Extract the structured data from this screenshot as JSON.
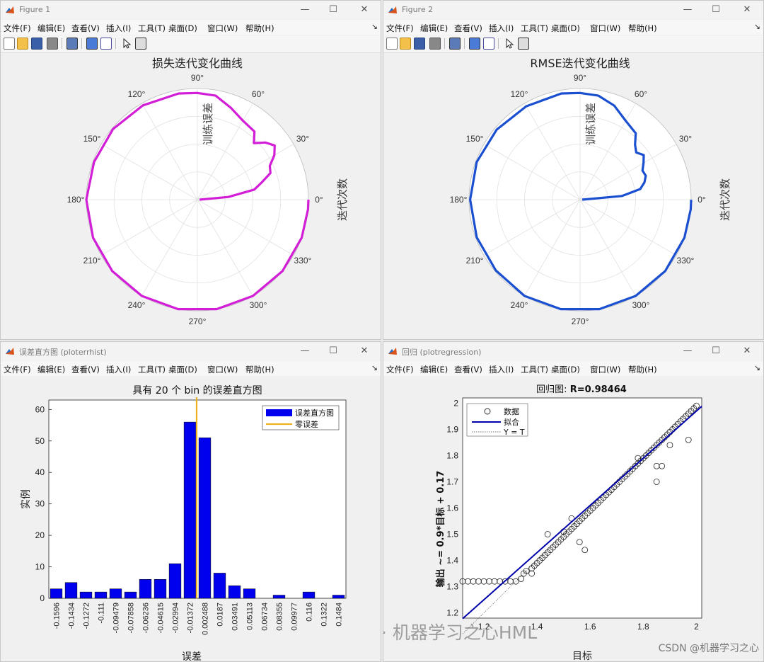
{
  "menu_labels": [
    "文件(F)",
    "编辑(E)",
    "查看(V)",
    "插入(I)",
    "工具(T)",
    "桌面(D)",
    "窗口(W)",
    "帮助(H)"
  ],
  "window_controls": {
    "minimize": "—",
    "maximize": "☐",
    "close": "✕"
  },
  "fig1": {
    "window_title": "Figure 1",
    "plot_title": "损失迭代变化曲线",
    "radial_label": "训练误差",
    "side_label": "迭代次数",
    "angle_labels": [
      "0°",
      "30°",
      "60°",
      "90°",
      "120°",
      "150°",
      "180°",
      "210°",
      "240°",
      "270°",
      "300°",
      "330°"
    ],
    "line_color": "#d21ed6"
  },
  "fig2": {
    "window_title": "Figure 2",
    "plot_title": "RMSE迭代变化曲线",
    "radial_label": "训练误差",
    "side_label": "迭代次数",
    "angle_labels": [
      "0°",
      "30°",
      "60°",
      "90°",
      "120°",
      "150°",
      "180°",
      "210°",
      "240°",
      "270°",
      "300°",
      "330°"
    ],
    "line_color": "#1a4fd0"
  },
  "hist": {
    "window_title": "误差直方图 (ploterrhist)",
    "legend_bar": "误差直方图",
    "legend_line": "零误差",
    "bar_color": "#0000ee",
    "zero_line_color": "#edb120"
  },
  "reg": {
    "window_title": "回归 (plotregression)",
    "legend_data": "数据",
    "legend_fit": "拟合",
    "legend_yt": "Y = T",
    "fit_color": "#0000aa"
  },
  "watermark": {
    "text": "公众号 · 机器学习之心HML",
    "csdn": "CSDN @机器学习之心"
  },
  "chart_data": [
    {
      "type": "line",
      "title": "损失迭代变化曲线",
      "polar": true,
      "radial_label": "训练误差",
      "angle_label": "迭代次数",
      "theta_ticks": [
        "0°",
        "30°",
        "60°",
        "90°",
        "120°",
        "150°",
        "180°",
        "210°",
        "240°",
        "270°",
        "300°",
        "330°"
      ],
      "theta_deg": [
        0,
        5,
        10,
        15,
        20,
        25,
        30,
        35,
        40,
        45,
        50,
        60,
        70,
        80,
        90,
        100,
        120,
        140,
        160,
        180,
        200,
        220,
        240,
        260,
        280,
        300,
        320,
        340,
        355,
        360
      ],
      "r": [
        0.02,
        0.28,
        0.52,
        0.6,
        0.7,
        0.72,
        0.8,
        0.85,
        0.8,
        0.72,
        0.8,
        0.82,
        0.88,
        0.95,
        0.96,
        0.97,
        0.98,
        0.99,
        0.99,
        1.0,
        1.0,
        1.0,
        1.0,
        1.0,
        1.0,
        1.0,
        1.0,
        1.0,
        1.0,
        1.0
      ]
    },
    {
      "type": "line",
      "title": "RMSE迭代变化曲线",
      "polar": true,
      "radial_label": "训练误差",
      "angle_label": "迭代次数",
      "theta_ticks": [
        "0°",
        "30°",
        "60°",
        "90°",
        "120°",
        "150°",
        "180°",
        "210°",
        "240°",
        "270°",
        "300°",
        "330°"
      ],
      "theta_deg": [
        0,
        5,
        10,
        15,
        20,
        25,
        30,
        35,
        40,
        45,
        50,
        60,
        70,
        80,
        90,
        100,
        120,
        140,
        160,
        180,
        200,
        220,
        240,
        260,
        280,
        300,
        320,
        340,
        355,
        360
      ],
      "r": [
        0.02,
        0.38,
        0.55,
        0.6,
        0.63,
        0.62,
        0.66,
        0.7,
        0.66,
        0.7,
        0.78,
        0.82,
        0.9,
        0.95,
        0.96,
        0.97,
        0.97,
        0.98,
        0.99,
        0.99,
        0.99,
        0.99,
        1.0,
        1.0,
        1.0,
        1.0,
        1.0,
        1.0,
        1.0,
        1.0
      ]
    },
    {
      "type": "bar",
      "title": "具有 20 个 bin 的误差直方图",
      "xlabel": "误差",
      "ylabel": "实例",
      "ylim": [
        0,
        63
      ],
      "yticks": [
        0,
        10,
        20,
        30,
        40,
        50,
        60
      ],
      "categories": [
        "-0.1596",
        "-0.1434",
        "-0.1272",
        "-0.111",
        "-0.09479",
        "-0.07858",
        "-0.06236",
        "-0.04615",
        "-0.02994",
        "-0.01372",
        "0.002488",
        "0.0187",
        "0.03491",
        "0.05113",
        "0.06734",
        "0.08355",
        "0.09977",
        "0.116",
        "0.1322",
        "0.1484"
      ],
      "values": [
        3,
        5,
        2,
        2,
        3,
        2,
        6,
        6,
        11,
        56,
        51,
        8,
        4,
        3,
        0,
        1,
        0,
        2,
        0,
        1
      ],
      "zero_error_index": 10,
      "legend": [
        "误差直方图",
        "零误差"
      ],
      "legend_position": "top-right"
    },
    {
      "type": "scatter",
      "title": "回归图: R=0.98464",
      "xlabel": "目标",
      "ylabel": "输出 ~= 0.9*目标 + 0.17",
      "xlim": [
        1.12,
        2.02
      ],
      "ylim": [
        1.18,
        2.02
      ],
      "xticks": [
        1.2,
        1.4,
        1.6,
        1.8,
        2
      ],
      "yticks": [
        1.2,
        1.3,
        1.4,
        1.5,
        1.6,
        1.7,
        1.8,
        1.9,
        2
      ],
      "fit": {
        "slope": 0.9,
        "intercept": 0.17
      },
      "legend": [
        "数据",
        "拟合",
        "Y = T"
      ],
      "legend_position": "top-left",
      "x": [
        1.12,
        1.14,
        1.16,
        1.18,
        1.2,
        1.22,
        1.24,
        1.26,
        1.28,
        1.3,
        1.32,
        1.34,
        1.35,
        1.36,
        1.38,
        1.39,
        1.4,
        1.41,
        1.42,
        1.43,
        1.44,
        1.45,
        1.46,
        1.47,
        1.48,
        1.49,
        1.5,
        1.5,
        1.51,
        1.52,
        1.53,
        1.54,
        1.55,
        1.56,
        1.57,
        1.58,
        1.59,
        1.6,
        1.61,
        1.62,
        1.63,
        1.64,
        1.65,
        1.66,
        1.67,
        1.68,
        1.69,
        1.7,
        1.71,
        1.72,
        1.73,
        1.74,
        1.75,
        1.76,
        1.77,
        1.78,
        1.79,
        1.8,
        1.81,
        1.82,
        1.83,
        1.84,
        1.85,
        1.86,
        1.87,
        1.88,
        1.89,
        1.9,
        1.91,
        1.92,
        1.93,
        1.94,
        1.95,
        1.96,
        1.97,
        1.98,
        1.99,
        2.0,
        1.53,
        1.58,
        1.38,
        1.85,
        1.9,
        1.97,
        1.85,
        1.87,
        1.44,
        1.56,
        1.78
      ],
      "y": [
        1.32,
        1.32,
        1.32,
        1.32,
        1.32,
        1.32,
        1.32,
        1.32,
        1.32,
        1.32,
        1.32,
        1.33,
        1.35,
        1.36,
        1.37,
        1.38,
        1.39,
        1.4,
        1.41,
        1.42,
        1.43,
        1.44,
        1.45,
        1.46,
        1.47,
        1.48,
        1.49,
        1.51,
        1.5,
        1.51,
        1.52,
        1.53,
        1.54,
        1.55,
        1.56,
        1.57,
        1.58,
        1.59,
        1.6,
        1.61,
        1.62,
        1.63,
        1.64,
        1.65,
        1.66,
        1.67,
        1.68,
        1.69,
        1.7,
        1.71,
        1.72,
        1.73,
        1.74,
        1.75,
        1.76,
        1.77,
        1.78,
        1.79,
        1.8,
        1.81,
        1.82,
        1.83,
        1.84,
        1.85,
        1.86,
        1.87,
        1.88,
        1.89,
        1.9,
        1.91,
        1.92,
        1.93,
        1.94,
        1.95,
        1.96,
        1.97,
        1.98,
        1.99,
        1.56,
        1.44,
        1.35,
        1.7,
        1.84,
        1.86,
        1.76,
        1.76,
        1.5,
        1.47,
        1.79
      ]
    }
  ]
}
